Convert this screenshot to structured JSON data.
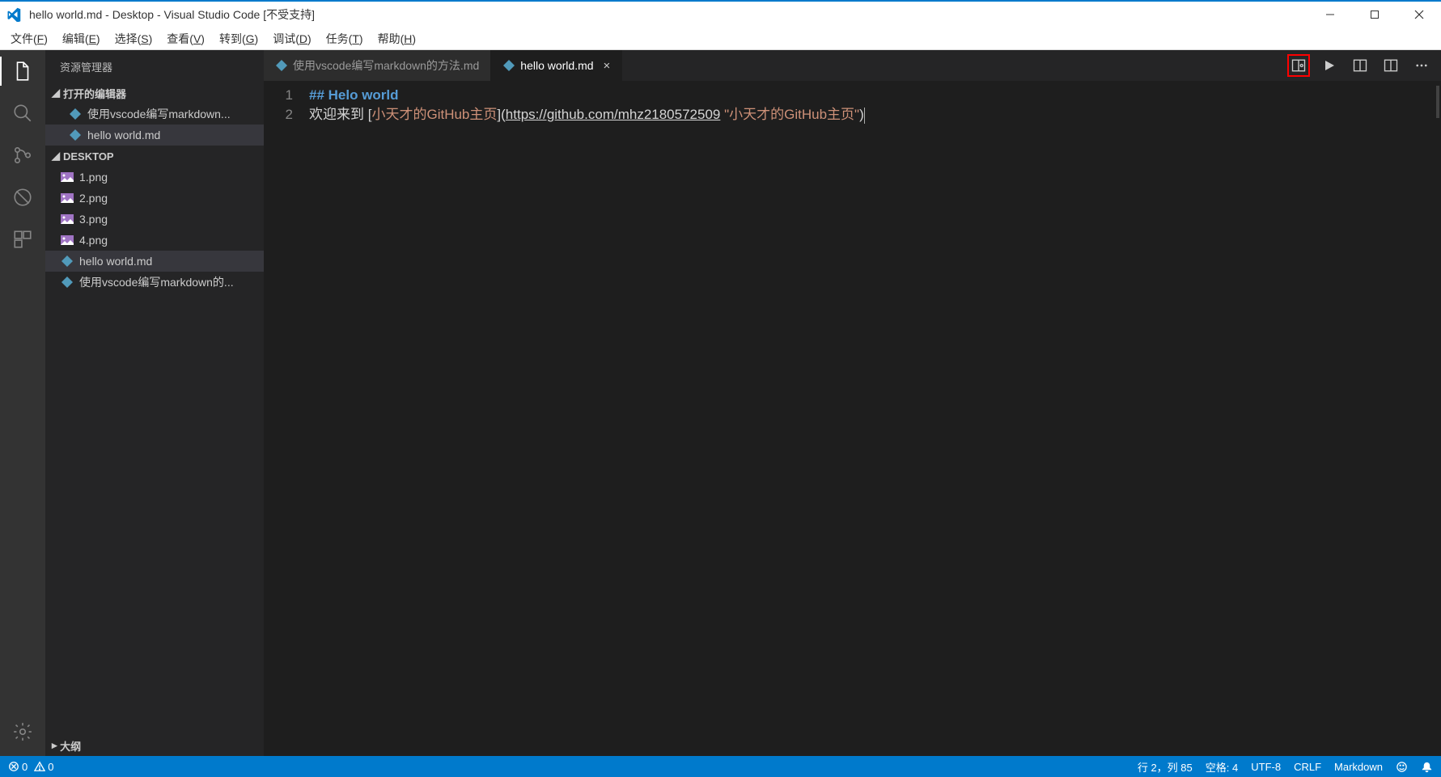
{
  "window": {
    "title": "hello world.md - Desktop - Visual Studio Code [不受支持]"
  },
  "menu": {
    "file": "文件(",
    "file_u": "F",
    "file_e": ")",
    "edit": "编辑(",
    "edit_u": "E",
    "edit_e": ")",
    "select": "选择(",
    "select_u": "S",
    "select_e": ")",
    "view": "查看(",
    "view_u": "V",
    "view_e": ")",
    "goto": "转到(",
    "goto_u": "G",
    "goto_e": ")",
    "debug": "调试(",
    "debug_u": "D",
    "debug_e": ")",
    "task": "任务(",
    "task_u": "T",
    "task_e": ")",
    "help": "帮助(",
    "help_u": "H",
    "help_e": ")"
  },
  "sidebar": {
    "title": "资源管理器",
    "openeditors": "打开的编辑器",
    "open_items": [
      "使用vscode编写markdown...",
      "hello world.md"
    ],
    "workspace": "DESKTOP",
    "files": [
      "1.png",
      "2.png",
      "3.png",
      "4.png",
      "hello world.md",
      "使用vscode编写markdown的..."
    ],
    "outline": "大纲"
  },
  "tabs": [
    {
      "label": "使用vscode编写markdown的方法.md",
      "active": false
    },
    {
      "label": "hello world.md",
      "active": true
    }
  ],
  "code": {
    "lines": [
      "1",
      "2"
    ],
    "l1": "## Helo world",
    "l2_pre": "欢迎来到 ",
    "l2_lb": "[",
    "l2_text": "小天才的GitHub主页",
    "l2_rb": "]",
    "l2_lp": "(",
    "l2_url": "https://github.com/mhz2180572509",
    "l2_sp": " ",
    "l2_title": "\"小天才的GitHub主页\"",
    "l2_rp": ")"
  },
  "status": {
    "errors": "0",
    "warnings": "0",
    "lncol": "行 2，列 85",
    "spaces": "空格: 4",
    "encoding": "UTF-8",
    "eol": "CRLF",
    "lang": "Markdown"
  }
}
